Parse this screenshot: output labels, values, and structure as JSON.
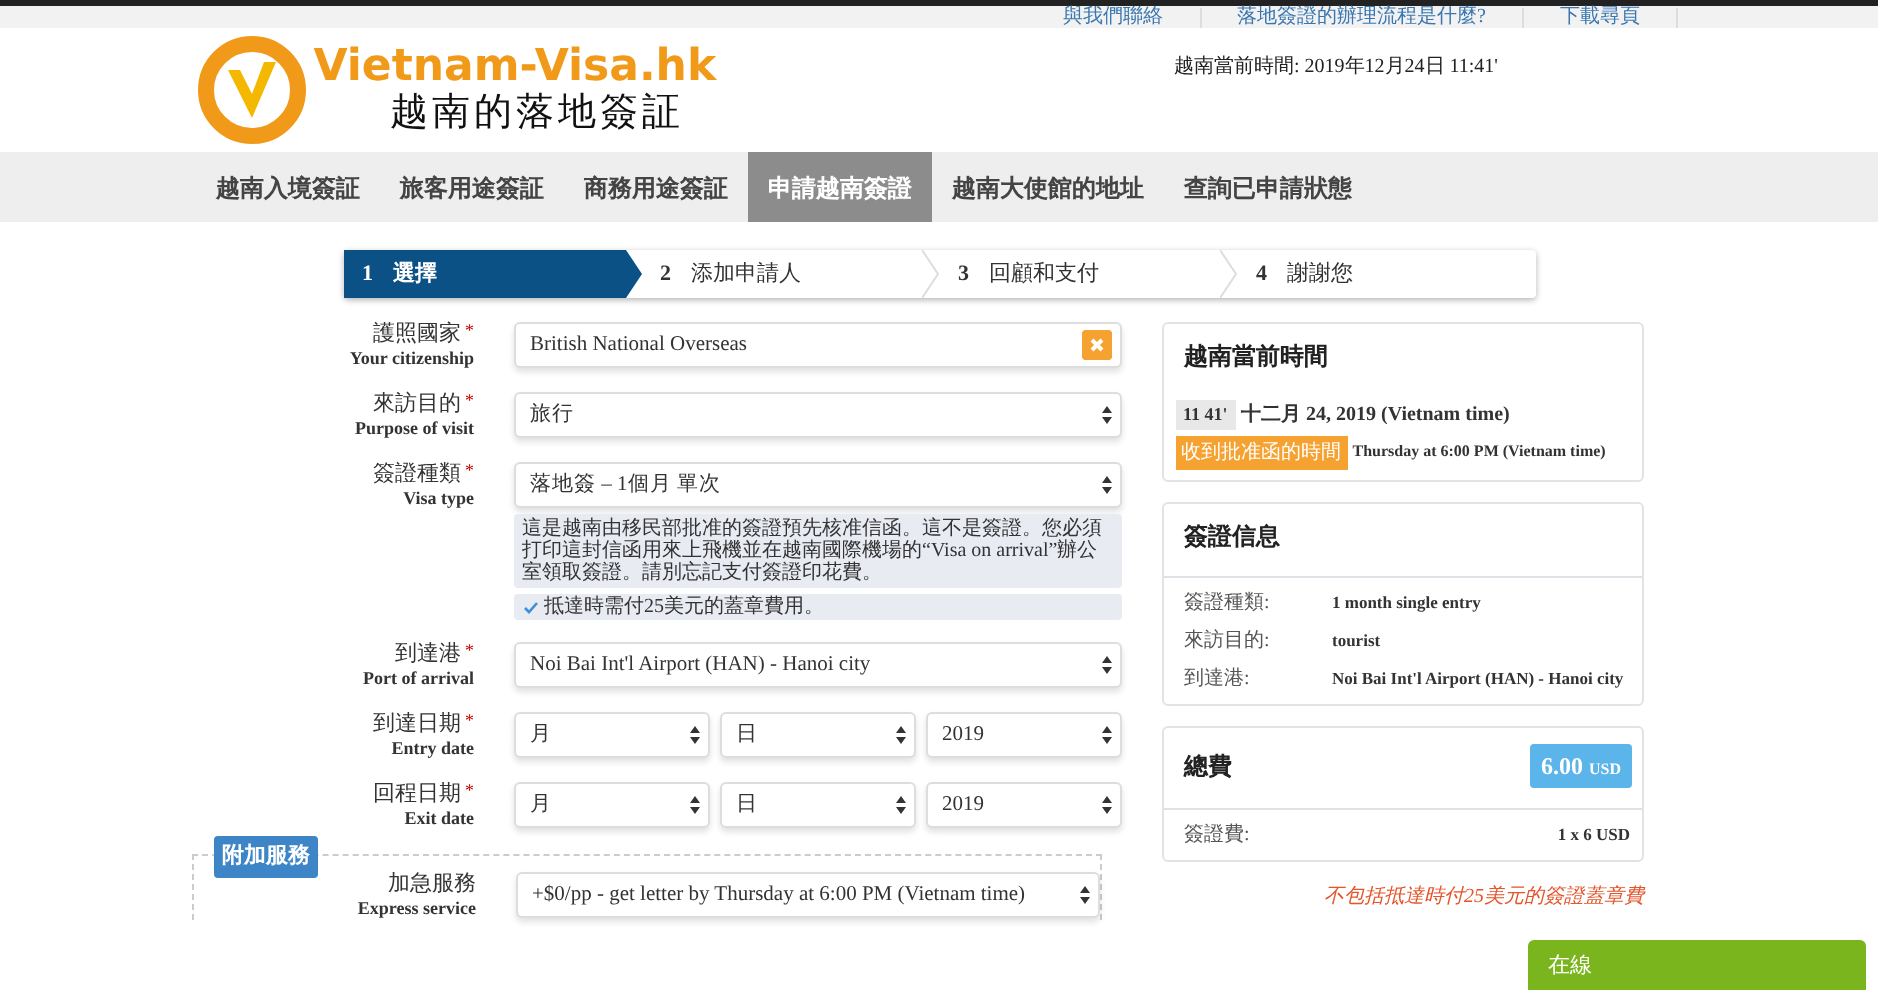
{
  "top_links": [
    "與我們聯絡",
    "落地簽證的辦理流程是什麼?",
    "下載尋頁"
  ],
  "logo": {
    "name": "Vietnam-Visa.hk",
    "tagline": "越南的落地簽証"
  },
  "header_time": "越南當前時間: 2019年12月24日 11:41'",
  "nav": [
    {
      "label": "越南入境簽証",
      "selected": false
    },
    {
      "label": "旅客用途簽証",
      "selected": false
    },
    {
      "label": "商務用途簽証",
      "selected": false
    },
    {
      "label": "申請越南簽證",
      "selected": true
    },
    {
      "label": "越南大使館的地址",
      "selected": false
    },
    {
      "label": "查詢已申請狀態",
      "selected": false
    }
  ],
  "steps": [
    {
      "number": "1",
      "label": "選擇",
      "selected": true
    },
    {
      "number": "2",
      "label": "添加申請人",
      "selected": false
    },
    {
      "number": "3",
      "label": "回顧和支付",
      "selected": false
    },
    {
      "number": "4",
      "label": "謝謝您",
      "selected": false
    }
  ],
  "fields": [
    {
      "kind": "clearable",
      "label": "護照國家",
      "sublabel": "Your citizenship",
      "mark": "*",
      "value": "British National Overseas"
    },
    {
      "kind": "select",
      "label": "來訪目的",
      "sublabel": "Purpose of visit",
      "mark": "*",
      "value": "旅行"
    },
    {
      "kind": "select",
      "label": "簽證種類",
      "sublabel": "Visa type",
      "mark": "*",
      "value": "落地簽 – 1個月 單次",
      "notes": [
        {
          "kind": "info",
          "text": "這是越南由移民部批准的簽證預先核准信函。這不是簽證。您必須打印這封信函用來上飛機並在越南國際機場的“Visa on arrival”辦公室領取簽證。請別忘記支付簽證印花費。"
        },
        {
          "kind": "check",
          "text": "抵達時需付25美元的蓋章費用。"
        }
      ]
    },
    {
      "kind": "select",
      "label": "到達港",
      "sublabel": "Port of arrival",
      "mark": "*",
      "value": "Noi Bai Int'l Airport (HAN) - Hanoi city"
    },
    {
      "kind": "date",
      "label": "到達日期",
      "sublabel": "Entry date",
      "mark": "*",
      "parts": [
        "月",
        "日",
        "2019"
      ]
    },
    {
      "kind": "date",
      "label": "回程日期",
      "sublabel": "Exit date",
      "mark": "*",
      "parts": [
        "月",
        "日",
        "2019"
      ]
    }
  ],
  "extra_services": {
    "legend": "附加服務",
    "fields": [
      {
        "kind": "select",
        "label": "加急服務",
        "sublabel": "Express service",
        "value": "+$0/pp - get letter by Thursday at 6:00 PM (Vietnam time)"
      }
    ]
  },
  "time_panel": {
    "title": "越南當前時間",
    "clock": "11 41'",
    "date": "十二月 24, 2019 (Vietnam time)",
    "badge": "收到批准函的時間",
    "badge_note": "Thursday at 6:00 PM (Vietnam time)"
  },
  "visa_info": {
    "title": "簽證信息",
    "rows": [
      {
        "label": "簽證種類:",
        "value": "1 month single entry"
      },
      {
        "label": "來訪目的:",
        "value": "tourist"
      },
      {
        "label": "到達港:",
        "value": "Noi Bai Int'l Airport (HAN) - Hanoi city"
      }
    ]
  },
  "total": {
    "title": "總費",
    "amount": "6.00",
    "currency": "USD",
    "rows": [
      {
        "label": "簽證費:",
        "value": "1 x 6 USD"
      }
    ]
  },
  "footnote": "不包括抵達時付25美元的簽證蓋章費",
  "chat": {
    "label": "在線"
  }
}
